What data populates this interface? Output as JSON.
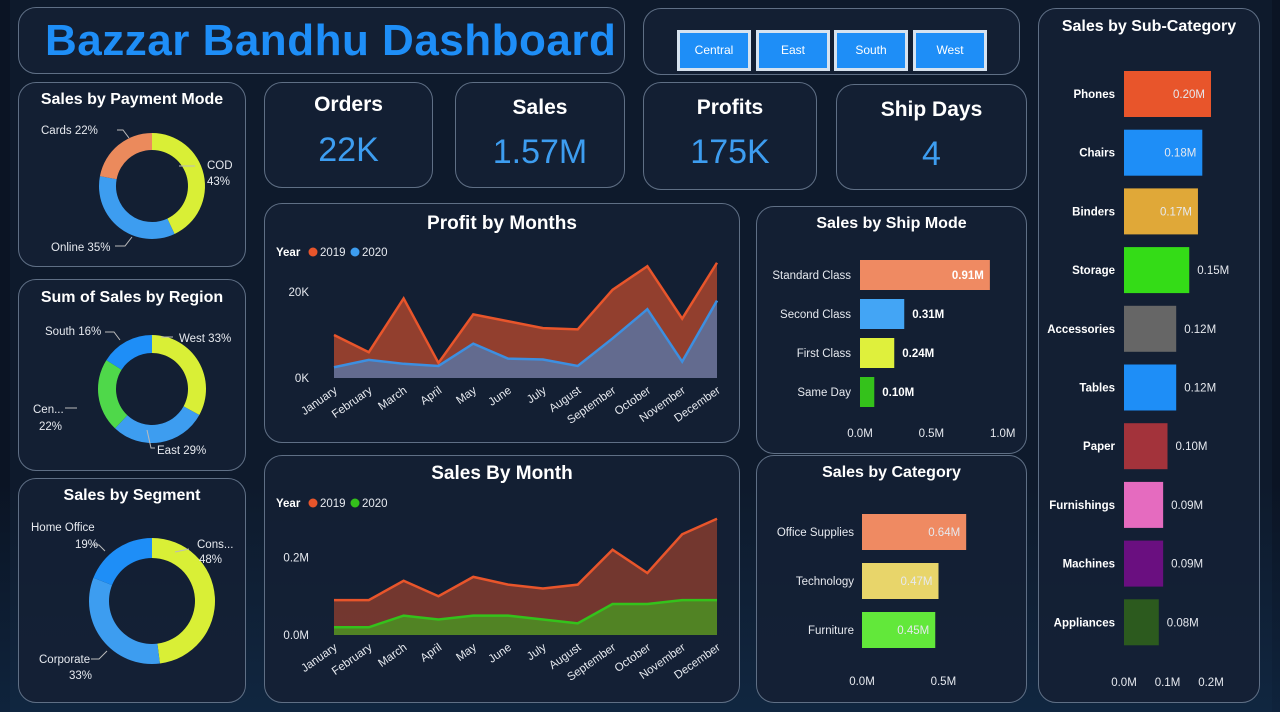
{
  "title": "Bazzar Bandhu Dashboard",
  "regions_filter": [
    "Central",
    "East",
    "South",
    "West"
  ],
  "kpis": {
    "orders": {
      "label": "Orders",
      "value": "22K"
    },
    "sales": {
      "label": "Sales",
      "value": "1.57M"
    },
    "profits": {
      "label": "Profits",
      "value": "175K"
    },
    "ship_days": {
      "label": "Ship Days",
      "value": "4"
    }
  },
  "colors": {
    "accent": "#3d9df0",
    "y2019": "#e8552b",
    "y2020_profit": "#3d8fe0",
    "y2020_sales": "#34c21b"
  },
  "months": [
    "January",
    "February",
    "March",
    "April",
    "May",
    "June",
    "July",
    "August",
    "September",
    "October",
    "November",
    "December"
  ],
  "chart_data": [
    {
      "id": "payment_mode",
      "type": "pie",
      "title": "Sales by Payment Mode",
      "labels": [
        "Cards 22%",
        "COD",
        "43%",
        "Online 35%"
      ],
      "slices": [
        {
          "name": "COD",
          "value": 43,
          "color": "#d9ef36"
        },
        {
          "name": "Online",
          "value": 35,
          "color": "#3d9df0"
        },
        {
          "name": "Cards",
          "value": 22,
          "color": "#eb8a5c"
        }
      ]
    },
    {
      "id": "region",
      "type": "pie",
      "title": "Sum of Sales by Region",
      "labels": [
        "South 16%",
        "West 33%",
        "Cen...",
        "22%",
        "East 29%"
      ],
      "slices": [
        {
          "name": "West",
          "value": 33,
          "color": "#d9ef36"
        },
        {
          "name": "East",
          "value": 29,
          "color": "#3d9df0"
        },
        {
          "name": "Central",
          "value": 22,
          "color": "#4fd84a"
        },
        {
          "name": "South",
          "value": 16,
          "color": "#1e8ef7"
        }
      ]
    },
    {
      "id": "segment",
      "type": "pie",
      "title": "Sales by Segment",
      "labels": [
        "Home Office",
        "19%",
        "Cons...",
        "48%",
        "Corporate",
        "33%"
      ],
      "slices": [
        {
          "name": "Consumer",
          "value": 48,
          "color": "#d9ef36"
        },
        {
          "name": "Corporate",
          "value": 33,
          "color": "#3d9df0"
        },
        {
          "name": "Home Office",
          "value": 19,
          "color": "#1e8ef7"
        }
      ]
    },
    {
      "id": "profit_by_months",
      "type": "area",
      "title": "Profit by Months",
      "legend_title": "Year",
      "series": [
        {
          "name": "2019",
          "values": [
            2500,
            4200,
            3300,
            2800,
            8000,
            4500,
            4300,
            2800,
            9200,
            16000,
            3800,
            18000
          ]
        },
        {
          "name": "2020",
          "values": [
            10000,
            6000,
            18500,
            3500,
            14800,
            13200,
            11600,
            11300,
            20500,
            26000,
            13800,
            26800
          ]
        }
      ],
      "yticks": [
        "0K",
        "20K"
      ],
      "ylim": [
        0,
        30000
      ]
    },
    {
      "id": "sales_by_month",
      "type": "area",
      "title": "Sales By Month",
      "legend_title": "Year",
      "series": [
        {
          "name": "2019",
          "values": [
            0.02,
            0.02,
            0.05,
            0.04,
            0.05,
            0.05,
            0.04,
            0.03,
            0.08,
            0.08,
            0.09,
            0.09
          ]
        },
        {
          "name": "2020",
          "values": [
            0.09,
            0.09,
            0.14,
            0.1,
            0.15,
            0.13,
            0.12,
            0.13,
            0.22,
            0.16,
            0.26,
            0.3
          ]
        }
      ],
      "yticks": [
        "0.0M",
        "0.2M"
      ],
      "ylim": [
        0,
        0.32
      ]
    },
    {
      "id": "ship_mode",
      "type": "bar",
      "title": "Sales by Ship Mode",
      "categories": [
        "Standard Class",
        "Second Class",
        "First Class",
        "Same Day"
      ],
      "values": [
        0.91,
        0.31,
        0.24,
        0.1
      ],
      "value_labels": [
        "0.91M",
        "0.31M",
        "0.24M",
        "0.10M"
      ],
      "colors": [
        "#ef8a62",
        "#43a5f5",
        "#dff03c",
        "#34c21b"
      ],
      "xticks": [
        "0.0M",
        "0.5M",
        "1.0M"
      ],
      "xlim": [
        0,
        1.1
      ]
    },
    {
      "id": "category",
      "type": "bar",
      "title": "Sales by Category",
      "categories": [
        "Office Supplies",
        "Technology",
        "Furniture"
      ],
      "values": [
        0.64,
        0.47,
        0.45
      ],
      "value_labels": [
        "0.64M",
        "0.47M",
        "0.45M"
      ],
      "colors": [
        "#ef8a62",
        "#e8d56a",
        "#62e83a"
      ],
      "xticks": [
        "0.0M",
        "0.5M"
      ],
      "xlim": [
        0,
        0.86
      ]
    },
    {
      "id": "sub_category",
      "type": "bar",
      "title": "Sales by Sub-Category",
      "categories": [
        "Phones",
        "Chairs",
        "Binders",
        "Storage",
        "Accessories",
        "Tables",
        "Paper",
        "Furnishings",
        "Machines",
        "Appliances"
      ],
      "values": [
        0.2,
        0.18,
        0.17,
        0.15,
        0.12,
        0.12,
        0.1,
        0.09,
        0.09,
        0.08
      ],
      "value_labels": [
        "0.20M",
        "0.18M",
        "0.17M",
        "0.15M",
        "0.12M",
        "0.12M",
        "0.10M",
        "0.09M",
        "0.09M",
        "0.08M"
      ],
      "colors": [
        "#e8552b",
        "#1e8ef7",
        "#e0a838",
        "#34dc17",
        "#666666",
        "#1e8ef7",
        "#a3333b",
        "#e56bbf",
        "#6a0f80",
        "#2c5a1e"
      ],
      "xticks": [
        "0.0M",
        "0.1M",
        "0.2M"
      ],
      "xlim": [
        0,
        0.2
      ]
    }
  ]
}
